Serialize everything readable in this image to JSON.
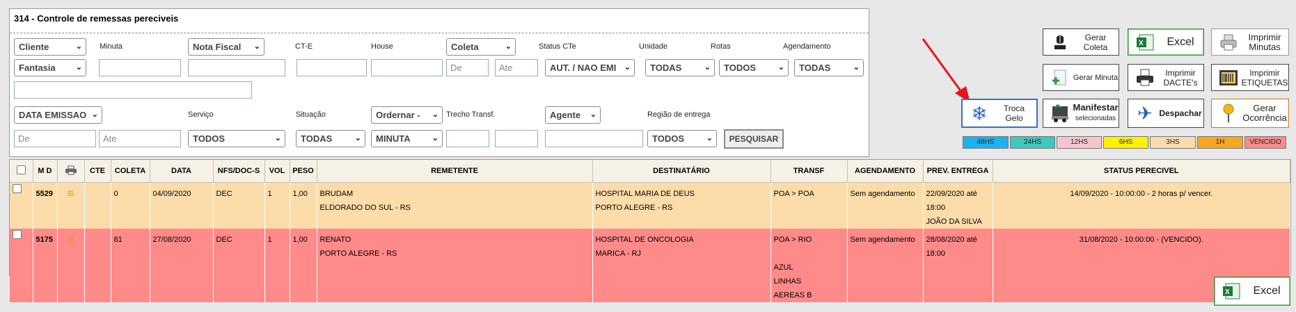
{
  "page": {
    "title": "314 - Controle de remessas pereciveis"
  },
  "filters": {
    "row1_selects": {
      "cliente": "Cliente",
      "nota_fiscal": "Nota Fiscal",
      "coleta": "Coleta"
    },
    "row1_labels": {
      "minuta": "Minuta",
      "cte": "CT-E",
      "house": "House",
      "status_cte": "Status CTe",
      "unidade": "Unidade",
      "rotas": "Rotas",
      "agendamento": "Agendamento"
    },
    "fantasia": "Fantasia",
    "coleta_de_placeholder": "De",
    "coleta_ate_placeholder": "Ate",
    "status_cte_value": "AUT. / NAO EMI",
    "unidade_value": "TODAS",
    "rotas_value": "TODOS",
    "agendamento_value": "TODAS",
    "data_emissao": "DATA EMISSAO",
    "row3_labels": {
      "servico": "Serviço",
      "situacao": "Situação",
      "trecho": "Trecho Transf.",
      "regiao": "Região de entrega"
    },
    "ordernar": "Ordernar -",
    "agente": "Agente",
    "data_de_placeholder": "De",
    "data_ate_placeholder": "Ate",
    "servico_value": "TODOS",
    "situacao_value": "TODAS",
    "ordem_value": "MINUTA",
    "regiao_value": "TODOS",
    "pesquisar_label": "PESQUISAR"
  },
  "toolbar": {
    "gerar_coleta": [
      "Gerar",
      "Coleta"
    ],
    "excel": "Excel",
    "imprimir_minutas": [
      "Imprimir",
      "Minutas"
    ],
    "gerar_minuta": "Gerar Minuta",
    "imprimir_dacte": [
      "Imprimir",
      "DACTE's"
    ],
    "imprimir_etiquetas": [
      "Imprimir",
      "ETIQUETAS"
    ],
    "troca_gelo": [
      "Troca",
      "Gelo"
    ],
    "manifestar": [
      "Manifestar",
      "selecionadas"
    ],
    "despachar": "Despachar",
    "gerar_ocorrencia": [
      "Gerar",
      "Ocorrência"
    ]
  },
  "legend": [
    {
      "label": "48HS",
      "color": "#1ab3f0"
    },
    {
      "label": "24HS",
      "color": "#3fc7c0"
    },
    {
      "label": "12HS",
      "color": "#f7c5cf"
    },
    {
      "label": "6HS",
      "color": "#fff200"
    },
    {
      "label": "3HS",
      "color": "#f8dcae"
    },
    {
      "label": "1H",
      "color": "#f5a623"
    },
    {
      "label": "VENCIDO",
      "color": "#ff8a8a"
    }
  ],
  "table": {
    "headers": [
      "",
      "M D",
      "",
      "CTE",
      "COLETA",
      "DATA",
      "NFS/DOC-S",
      "VOL",
      "PESO",
      "REMETENTE",
      "DESTINATÁRIO",
      "TRANSF",
      "AGENDAMENTO",
      "PREV. ENTREGA",
      "STATUS PERECIVEL"
    ],
    "rows": [
      {
        "md": "5529",
        "cte": "",
        "coleta": "0",
        "data": "04/09/2020",
        "nfs": "DEC",
        "vol": "1",
        "peso": "1,00",
        "remetente": "BRUDAM",
        "remetente_cidade": "ELDORADO DO SUL - RS",
        "destinatario": "HOSPITAL MARIA DE DEUS",
        "destinatario_cidade": "PORTO ALEGRE - RS",
        "transf": "POA > POA",
        "transf_extra": "",
        "agendamento": "Sem agendamento",
        "prev_entrega": "22/09/2020 até 18:00",
        "prev_responsavel": "JOÃO DA SILVA",
        "status": "14/09/2020 - 10:00:00 - 2 horas p/ vencer."
      },
      {
        "md": "5175",
        "cte": "",
        "coleta": "81",
        "data": "27/08/2020",
        "nfs": "DEC",
        "vol": "1",
        "peso": "1,00",
        "remetente": "RENATO",
        "remetente_cidade": "PORTO ALEGRE - RS",
        "destinatario": "HOSPITAL DE ONCOLOGIA",
        "destinatario_cidade": "MARICA - RJ",
        "transf": "POA > RIO",
        "transf_extra": "AZUL LINHAS AEREAS B",
        "agendamento": "Sem agendamento",
        "prev_entrega": "28/08/2020 até 18:00",
        "prev_responsavel": "",
        "status": "31/08/2020 - 10:00:00 - (VENCIDO)."
      }
    ]
  },
  "footer": {
    "excel": "Excel"
  }
}
